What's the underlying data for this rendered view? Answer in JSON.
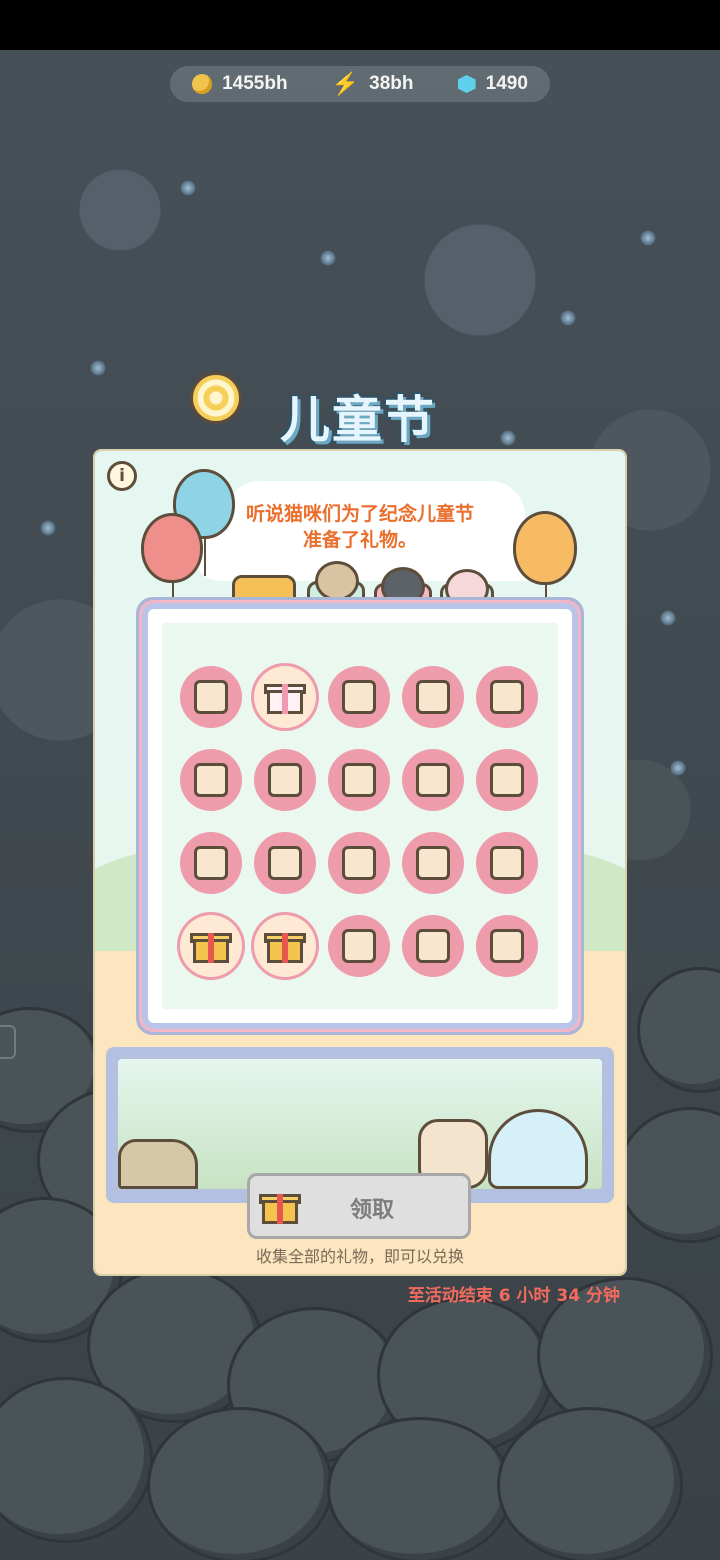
{
  "currency": {
    "coins": "1455bh",
    "energy": "38bh",
    "gems": "1490"
  },
  "event": {
    "title": "儿童节",
    "intro_line1": "听说猫咪们为了纪念儿童节",
    "intro_line2": "准备了礼物。",
    "info_label": "i"
  },
  "gifts": [
    {
      "icon": "house-icon",
      "collected": true
    },
    {
      "icon": "gift-wrapped-icon",
      "collected": true
    },
    {
      "icon": "cockatoo-icon",
      "collected": true
    },
    {
      "icon": "backpack-icon",
      "collected": true
    },
    {
      "icon": "cap-icon",
      "collected": true
    },
    {
      "icon": "shirt-icon",
      "collected": true
    },
    {
      "icon": "hat-icon",
      "collected": true
    },
    {
      "icon": "lollipop-icon",
      "collected": true
    },
    {
      "icon": "wallpaper-icon",
      "collected": true
    },
    {
      "icon": "floor-tile-icon",
      "collected": true
    },
    {
      "icon": "cat-portrait-icon",
      "collected": true
    },
    {
      "icon": "map-icon",
      "collected": true
    },
    {
      "icon": "window-icon",
      "collected": true
    },
    {
      "icon": "piano-icon",
      "collected": true
    },
    {
      "icon": "hot-air-balloon-icon",
      "collected": true
    },
    {
      "icon": "gift-box-icon",
      "collected": false
    },
    {
      "icon": "gift-box-icon",
      "collected": false
    },
    {
      "icon": "mug-icon",
      "collected": true
    },
    {
      "icon": "mushroom-frame-icon",
      "collected": true
    },
    {
      "icon": "rocking-horse-icon",
      "collected": true
    }
  ],
  "exchange": {
    "claim_label": "领取",
    "hint": "收集全部的礼物，即可以兑换"
  },
  "timer": {
    "text": "至活动结束  6 小时 34 分钟"
  },
  "colors": {
    "accent_orange": "#ea6f2d",
    "slot_pink": "#ee9bac",
    "timer_red": "#f26b5c"
  }
}
